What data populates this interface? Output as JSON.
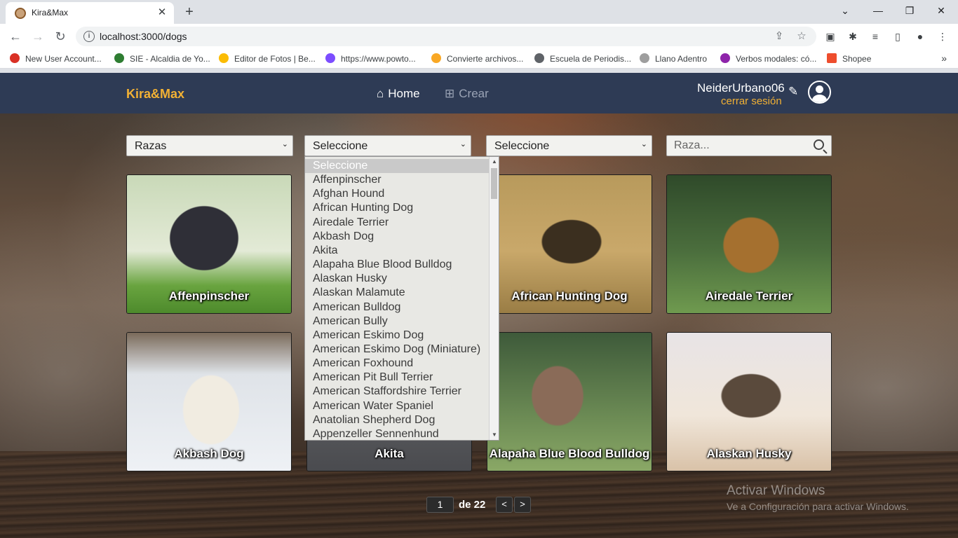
{
  "browser": {
    "tab_title": "Kira&Max",
    "url": "localhost:3000/dogs",
    "bookmarks": [
      {
        "label": "New User Account...",
        "color": "#d93025"
      },
      {
        "label": "SIE - Alcaldia de Yo...",
        "color": "#2e7d32"
      },
      {
        "label": "Editor de Fotos | Be...",
        "color": "#fbbc04"
      },
      {
        "label": "https://www.powto...",
        "color": "#7c4dff"
      },
      {
        "label": "Convierte archivos...",
        "color": "#f9a825"
      },
      {
        "label": "Escuela de Periodis...",
        "color": "#5f6368"
      },
      {
        "label": "Llano Adentro",
        "color": "#9e9e9e"
      },
      {
        "label": "Verbos modales: có...",
        "color": "#8e24aa"
      },
      {
        "label": "Shopee",
        "color": "#ee4d2d"
      }
    ]
  },
  "header": {
    "brand": "Kira&Max",
    "nav_home": "Home",
    "nav_create": "Crear",
    "username": "NeiderUrbano06",
    "logout": "cerrar sesión"
  },
  "filters": {
    "select1": "Razas",
    "select2": "Seleccione",
    "select3": "Seleccione",
    "search_placeholder": "Raza..."
  },
  "dropdown_options": [
    "Seleccione",
    "Affenpinscher",
    "Afghan Hound",
    "African Hunting Dog",
    "Airedale Terrier",
    "Akbash Dog",
    "Akita",
    "Alapaha Blue Blood Bulldog",
    "Alaskan Husky",
    "Alaskan Malamute",
    "American Bulldog",
    "American Bully",
    "American Eskimo Dog",
    "American Eskimo Dog (Miniature)",
    "American Foxhound",
    "American Pit Bull Terrier",
    "American Staffordshire Terrier",
    "American Water Spaniel",
    "Anatolian Shepherd Dog",
    "Appenzeller Sennenhund"
  ],
  "cards": [
    {
      "name": "Affenpinscher"
    },
    {
      "name": ""
    },
    {
      "name": "African Hunting Dog"
    },
    {
      "name": "Airedale Terrier"
    },
    {
      "name": "Akbash Dog"
    },
    {
      "name": "Akita"
    },
    {
      "name": "Alapaha Blue Blood Bulldog"
    },
    {
      "name": "Alaskan Husky"
    }
  ],
  "pagination": {
    "current": "1",
    "of_label": "de 22",
    "prev": "<",
    "next": ">"
  },
  "watermark": {
    "line1": "Activar Windows",
    "line2": "Ve a Configuración para activar Windows."
  }
}
